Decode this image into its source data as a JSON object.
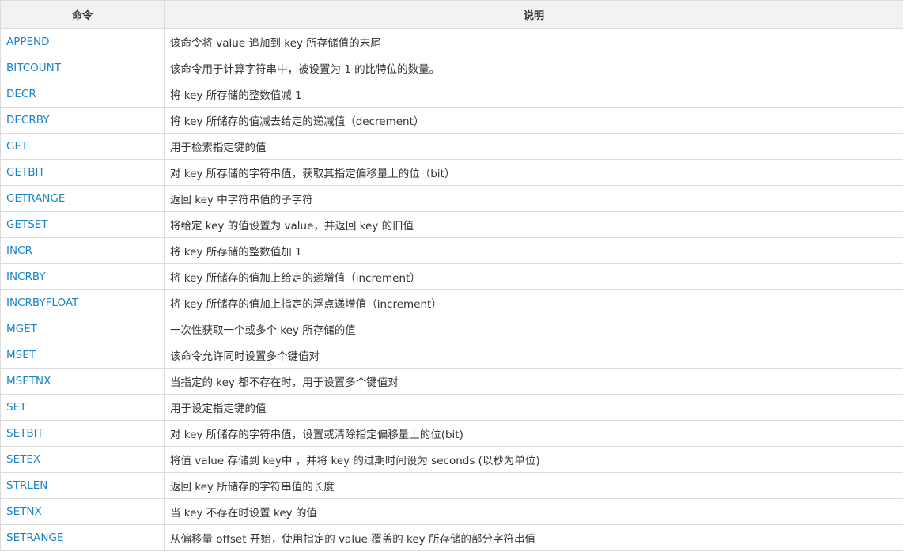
{
  "table": {
    "headers": {
      "command": "命令",
      "description": "说明"
    },
    "link_color": "#1b83c6",
    "rows": [
      {
        "command": "APPEND",
        "description": "该命令将 value 追加到 key 所存储值的末尾"
      },
      {
        "command": "BITCOUNT",
        "description": "该命令用于计算字符串中，被设置为 1 的比特位的数量。"
      },
      {
        "command": "DECR",
        "description": "将 key 所存储的整数值减 1"
      },
      {
        "command": "DECRBY",
        "description": "将 key 所储存的值减去给定的递减值（decrement）"
      },
      {
        "command": "GET",
        "description": "用于检索指定键的值"
      },
      {
        "command": "GETBIT",
        "description": "对 key 所存储的字符串值，获取其指定偏移量上的位（bit）"
      },
      {
        "command": "GETRANGE",
        "description": "返回 key 中字符串值的子字符"
      },
      {
        "command": "GETSET",
        "description": "将给定 key 的值设置为 value，并返回 key 的旧值"
      },
      {
        "command": "INCR",
        "description": "将 key 所存储的整数值加 1"
      },
      {
        "command": "INCRBY",
        "description": "将 key 所储存的值加上给定的递增值（increment）"
      },
      {
        "command": "INCRBYFLOAT",
        "description": "将 key 所储存的值加上指定的浮点递增值（increment）"
      },
      {
        "command": "MGET",
        "description": "一次性获取一个或多个 key 所存储的值"
      },
      {
        "command": "MSET",
        "description": "该命令允许同时设置多个键值对"
      },
      {
        "command": "MSETNX",
        "description": "当指定的 key 都不存在时，用于设置多个键值对"
      },
      {
        "command": "SET",
        "description": "用于设定指定键的值"
      },
      {
        "command": "SETBIT",
        "description": "对 key 所储存的字符串值，设置或清除指定偏移量上的位(bit)"
      },
      {
        "command": "SETEX",
        "description": "将值 value 存储到 key中 ，并将 key 的过期时间设为 seconds (以秒为单位)"
      },
      {
        "command": "STRLEN",
        "description": "返回 key 所储存的字符串值的长度"
      },
      {
        "command": "SETNX",
        "description": "当 key 不存在时设置 key 的值"
      },
      {
        "command": "SETRANGE",
        "description": "从偏移量 offset 开始，使用指定的 value 覆盖的 key 所存储的部分字符串值"
      }
    ]
  }
}
